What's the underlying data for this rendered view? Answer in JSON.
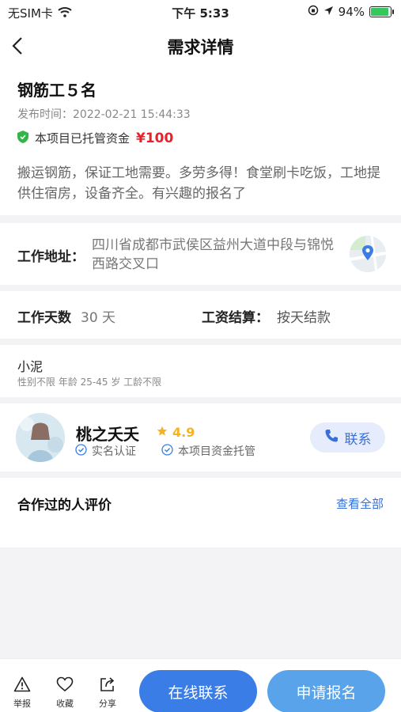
{
  "status_bar": {
    "carrier": "无SIM卡",
    "time": "下午 5:33",
    "battery": "94%",
    "battery_level": 0.94,
    "icons": [
      "wifi-icon",
      "lock-rotation-icon",
      "location-arrow-icon",
      "battery-icon"
    ]
  },
  "nav": {
    "title": "需求详情",
    "back_icon": "chevron-left-icon"
  },
  "job": {
    "title": "钢筋工５名",
    "post_time": "发布时间：2022-02-21 15:44:33",
    "escrow_text": "本项目已托管资金",
    "escrow_amount": "¥100",
    "description": "搬运钢筋，保证工地需要。多劳多得！食堂刷卡吃饭，工地提供住宿房，设备齐全。有兴趣的报名了"
  },
  "address": {
    "label": "工作地址：",
    "value": "四川省成都市武侯区益州大道中段与锦悦西路交叉口",
    "map_icon": "map-pin-icon"
  },
  "work": {
    "days_label": "工作天数",
    "days_value": "30 天",
    "pay_label": "工资结算：",
    "pay_value": "按天结款"
  },
  "requirements": {
    "title": "小泥",
    "detail": "性别不限 年龄 25-45 岁 工龄不限"
  },
  "employer": {
    "name": "桃之夭夭",
    "rating": "4.9",
    "verify_1": "实名认证",
    "verify_2": "本项目资金托管",
    "contact_label": "联系"
  },
  "reviews": {
    "title": "合作过的人评价",
    "view_all": "查看全部"
  },
  "bottom": {
    "report": "举报",
    "favorite": "收藏",
    "share": "分享",
    "online_contact": "在线联系",
    "apply": "申请报名"
  },
  "colors": {
    "accent_blue": "#3a7de6",
    "apply_blue": "#58a3ea",
    "price_red": "#e8212b",
    "star_gold": "#f5b324",
    "shield_green": "#33b54a"
  }
}
